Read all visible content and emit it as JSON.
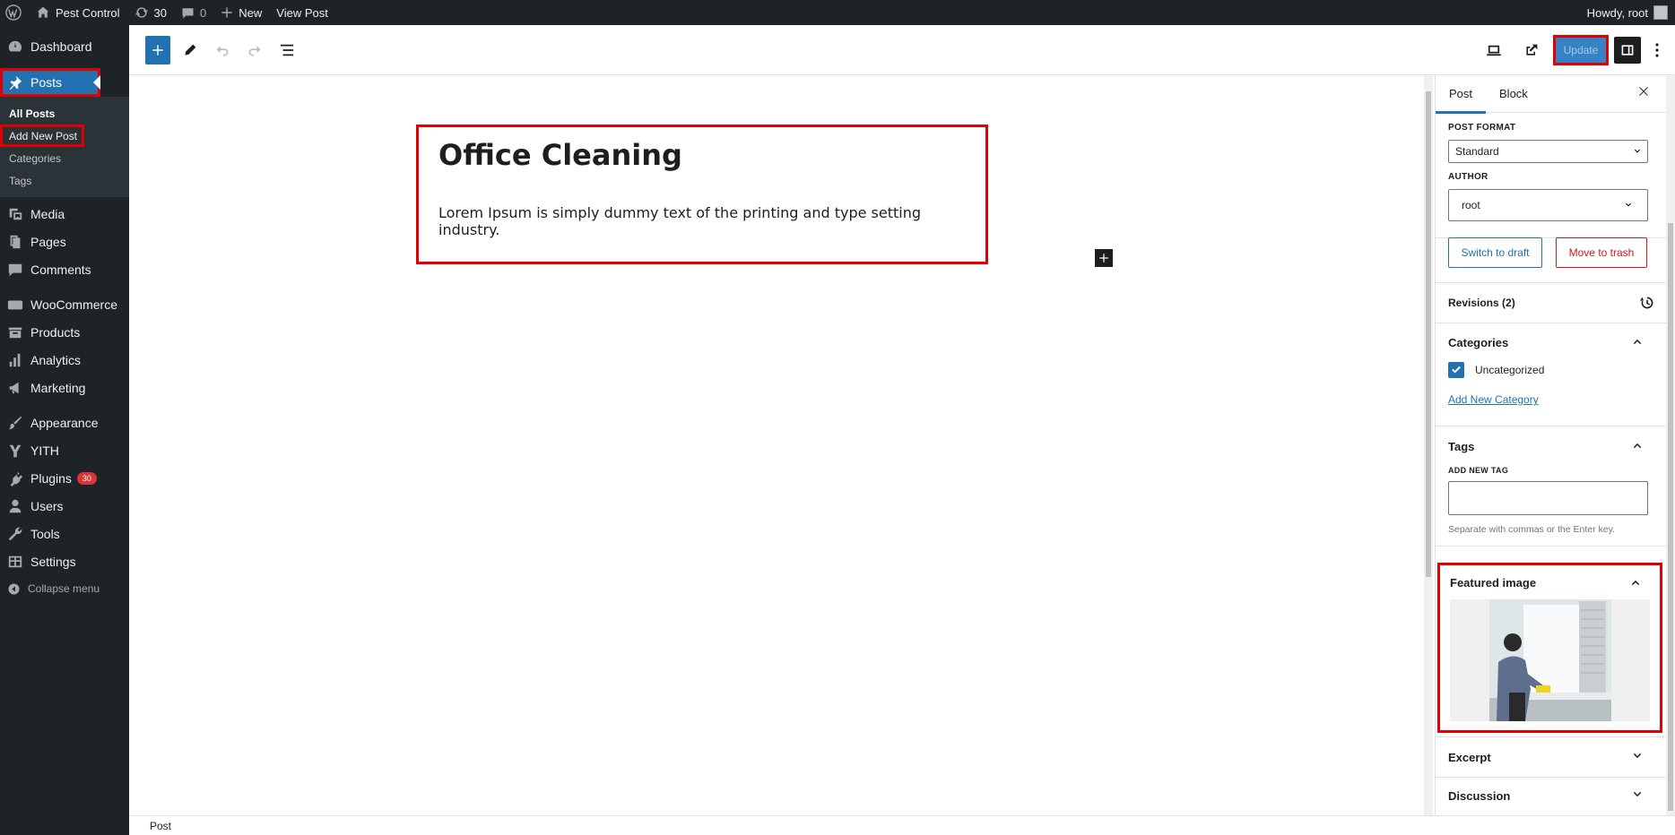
{
  "admin_bar": {
    "site_name": "Pest Control",
    "updates_count": "30",
    "comments_count": "0",
    "new_label": "New",
    "view_post_label": "View Post",
    "greeting": "Howdy, root"
  },
  "sidebar": {
    "dashboard": "Dashboard",
    "posts": "Posts",
    "posts_sub": [
      "All Posts",
      "Add New Post",
      "Categories",
      "Tags"
    ],
    "media": "Media",
    "pages": "Pages",
    "comments": "Comments",
    "woocommerce": "WooCommerce",
    "products": "Products",
    "analytics": "Analytics",
    "marketing": "Marketing",
    "appearance": "Appearance",
    "yith": "YITH",
    "plugins": "Plugins",
    "plugins_badge": "30",
    "users": "Users",
    "tools": "Tools",
    "settings": "Settings",
    "collapse": "Collapse menu"
  },
  "toolbar": {
    "update_label": "Update"
  },
  "post": {
    "title": "Office Cleaning",
    "paragraph": "Lorem Ipsum is simply dummy text of the printing and type setting industry."
  },
  "status_bar": {
    "breadcrumb": "Post"
  },
  "settings_panel": {
    "tabs": [
      "Post",
      "Block"
    ],
    "post_format_label": "POST FORMAT",
    "post_format_value": "Standard",
    "author_label": "AUTHOR",
    "author_value": "root",
    "switch_draft": "Switch to draft",
    "move_trash": "Move to trash",
    "revisions": "Revisions (2)",
    "categories_title": "Categories",
    "category_item": "Uncategorized",
    "add_category": "Add New Category",
    "tags_title": "Tags",
    "add_tag_label": "ADD NEW TAG",
    "tag_help": "Separate with commas or the Enter key.",
    "featured_title": "Featured image",
    "excerpt_title": "Excerpt",
    "discussion_title": "Discussion"
  },
  "colors": {
    "admin_dark": "#1d2327",
    "accent": "#2271b1",
    "highlight": "#e00000",
    "trash": "#cc1818"
  }
}
